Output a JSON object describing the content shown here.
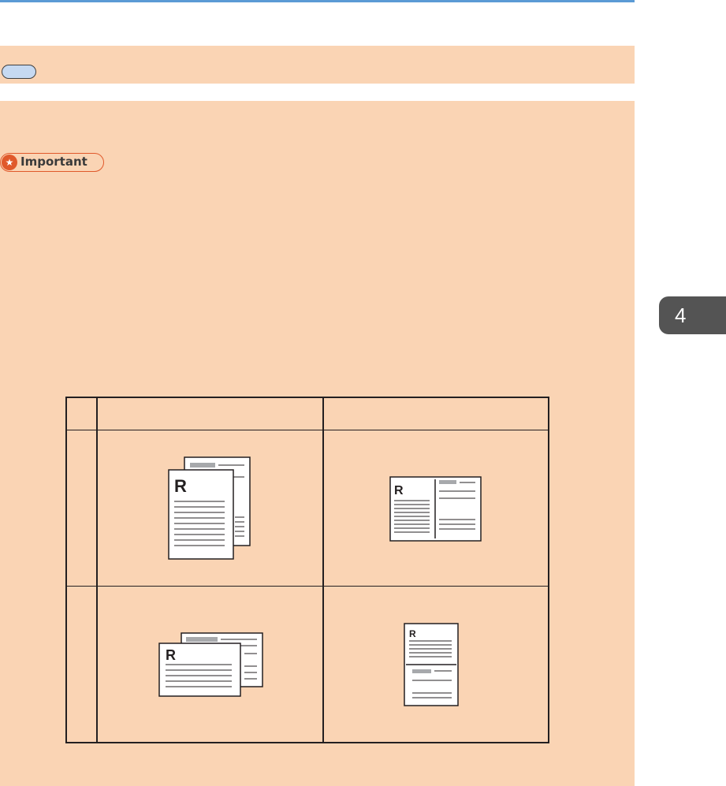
{
  "header": {
    "pill_label": ""
  },
  "important": {
    "label": "Important",
    "icon": "star-icon"
  },
  "chapter": {
    "number": "4"
  },
  "table": {
    "headers": [
      "",
      "",
      ""
    ],
    "rows": [
      {
        "label": "",
        "original_letter": "R",
        "result_letter": "R"
      },
      {
        "label": "",
        "original_letter": "R",
        "result_letter": "R"
      }
    ]
  },
  "colors": {
    "band": "#fad4b4",
    "pill": "#c6d9f1",
    "accent": "#e0592b",
    "rule": "#5b9bd5",
    "tab": "#545454"
  }
}
